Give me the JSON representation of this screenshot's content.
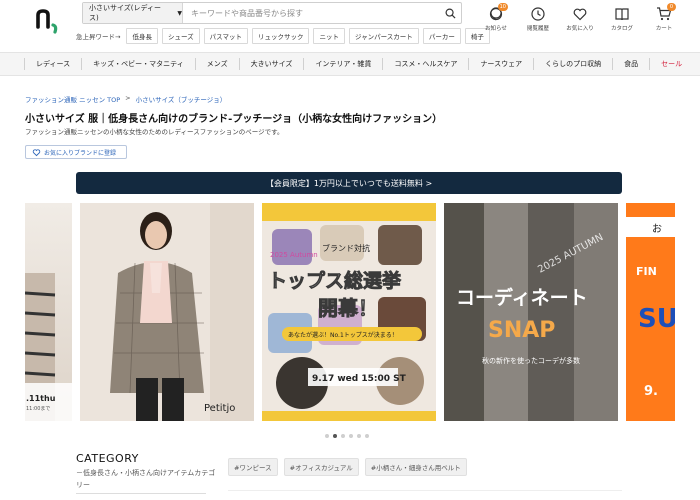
{
  "header": {
    "logo_text": "n,",
    "search": {
      "category": "小さいサイズ(レディース)",
      "placeholder": "キーワードや商品番号から探す"
    },
    "quick_words": {
      "label": "急上昇ワード→",
      "items": [
        "低身長",
        "シューズ",
        "パスマット",
        "リュックサック",
        "ニット",
        "ジャンパースカート",
        "パーカー",
        "椅子"
      ]
    },
    "icons": [
      {
        "name": "notification-icon",
        "label": "お知らせ",
        "badge": "10"
      },
      {
        "name": "history-icon",
        "label": "閲覧履歴",
        "badge": ""
      },
      {
        "name": "heart-icon",
        "label": "お気に入り",
        "badge": ""
      },
      {
        "name": "catalog-icon",
        "label": "カタログ",
        "badge": ""
      },
      {
        "name": "cart-icon",
        "label": "カート",
        "badge": "0"
      }
    ]
  },
  "nav": {
    "items": [
      "レディース",
      "キッズ・ベビー・マタニティ",
      "メンズ",
      "大きいサイズ",
      "インテリア・雑貨",
      "コスメ・ヘルスケア",
      "ナースウェア",
      "くらしのプロ収納",
      "食品",
      "セール"
    ]
  },
  "breadcrumb": [
    "ファッション通販 ニッセン TOP",
    ">",
    "小さいサイズ（ブッチージョ）"
  ],
  "page": {
    "title": "小さいサイズ 服｜低身長さん向けのブランド-プッチージョ（小柄な女性向けファッション）",
    "description": "ファッション通販ニッセンの小柄な女性のためのレディースファッションのページです。",
    "fav_button": "お気に入りブランドに登録",
    "promo": "【会員限定】1万円以上でいつでも送料無料 >"
  },
  "carousel": {
    "slide0_date": ".11thu",
    "slide0_time": "11:00まで",
    "slide1_brand": "Petitjo",
    "slide2_top": "2025 Autumn",
    "slide2_top2": "ブランド対抗",
    "slide2_main": "トップス総選挙",
    "slide2_main2": "開幕！",
    "slide2_sub": "あなたが選ぶ！No.1トップスが決まる！",
    "slide2_date": "9.17 wed 15:00 ST",
    "slide3_year": "2025 AUTUMN",
    "slide3_main": "コーディネート",
    "slide3_snap": "SNAP",
    "slide3_sub": "秋の新作を使ったコーデが多数",
    "slide4_top": "お",
    "slide4_mid": "FIN",
    "slide4_big": "SU S",
    "slide4_date": "9.",
    "dots_count": 6,
    "active_dot": 1
  },
  "category": {
    "title": "CATEGORY",
    "subtitle": "－低身長さん・小柄さん向けアイテムカテゴリー",
    "tags": [
      "#ワンピース",
      "#オフィスカジュアル",
      "#小柄さん・細身さん用ベルト"
    ]
  },
  "colors": {
    "promo_bg": "#13293f",
    "sale": "#d4213d",
    "link": "#2a63b8",
    "badge": "#f08a2b",
    "slide2_yellow": "#f3c73a",
    "slide4_orange": "#ff7a1a"
  }
}
